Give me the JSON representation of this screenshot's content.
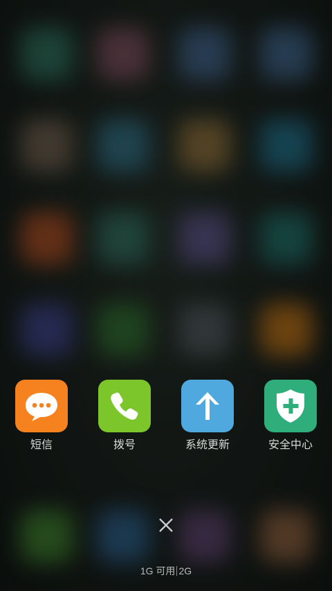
{
  "recents": [
    {
      "label": "短信",
      "icon": "message-icon",
      "color": "#F5821F"
    },
    {
      "label": "拨号",
      "icon": "phone-icon",
      "color": "#7CC62C"
    },
    {
      "label": "系统更新",
      "icon": "arrow-up-icon",
      "color": "#4FA9DE"
    },
    {
      "label": "安全中心",
      "icon": "shield-plus-icon",
      "color": "#2FAE7C"
    }
  ],
  "close_icon": "close-icon",
  "memory": {
    "available": "1G 可用",
    "total": "2G"
  }
}
